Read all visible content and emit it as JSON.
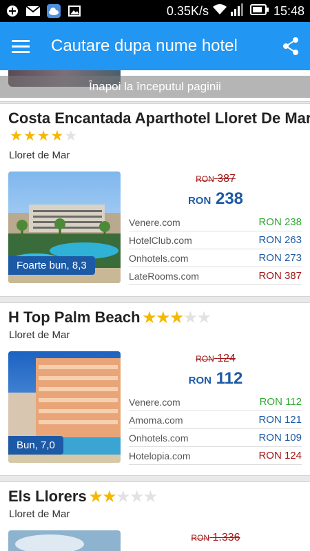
{
  "status_bar": {
    "speed": "0.35K/s",
    "time": "15:48",
    "icons": [
      "plus-icon",
      "mail-icon",
      "cloud-icon",
      "image-icon",
      "wifi-icon",
      "signal-icon",
      "battery-icon"
    ]
  },
  "app_bar": {
    "title": "Cautare dupa nume hotel",
    "menu_icon": "hamburger-menu-icon",
    "share_icon": "share-icon"
  },
  "back_to_top": "Înapoi la începutul paginii",
  "colors": {
    "app_bar": "#2196f3",
    "badge": "#1d5aa6",
    "old_price": "#a31515",
    "price_green": "#2fa832",
    "price_blue": "#1d5aa6",
    "price_red": "#a31515"
  },
  "hotels": [
    {
      "name": "Costa Encantada Aparthotel Lloret De Mar",
      "stars": 4,
      "city": "Lloret de Mar",
      "badge": "Foarte bun, 8,3",
      "old_currency": "RON",
      "old_amount": "387",
      "new_currency": "RON",
      "new_amount": "238",
      "offers": [
        {
          "site": "Venere.com",
          "price": "RON 238",
          "color": "green"
        },
        {
          "site": "HotelClub.com",
          "price": "RON 263",
          "color": "blue"
        },
        {
          "site": "Onhotels.com",
          "price": "RON 273",
          "color": "blue"
        },
        {
          "site": "LateRooms.com",
          "price": "RON 387",
          "color": "red"
        }
      ]
    },
    {
      "name": "H Top Palm Beach",
      "stars": 3,
      "city": "Lloret de Mar",
      "badge": "Bun, 7,0",
      "old_currency": "RON",
      "old_amount": "124",
      "new_currency": "RON",
      "new_amount": "112",
      "offers": [
        {
          "site": "Venere.com",
          "price": "RON 112",
          "color": "green"
        },
        {
          "site": "Amoma.com",
          "price": "RON 121",
          "color": "blue"
        },
        {
          "site": "Onhotels.com",
          "price": "RON 109",
          "color": "blue"
        },
        {
          "site": "Hotelopia.com",
          "price": "RON 124",
          "color": "red"
        }
      ]
    },
    {
      "name": "Els Llorers",
      "stars": 2,
      "city": "Lloret de Mar",
      "old_currency": "RON",
      "old_amount": "1.336"
    }
  ]
}
